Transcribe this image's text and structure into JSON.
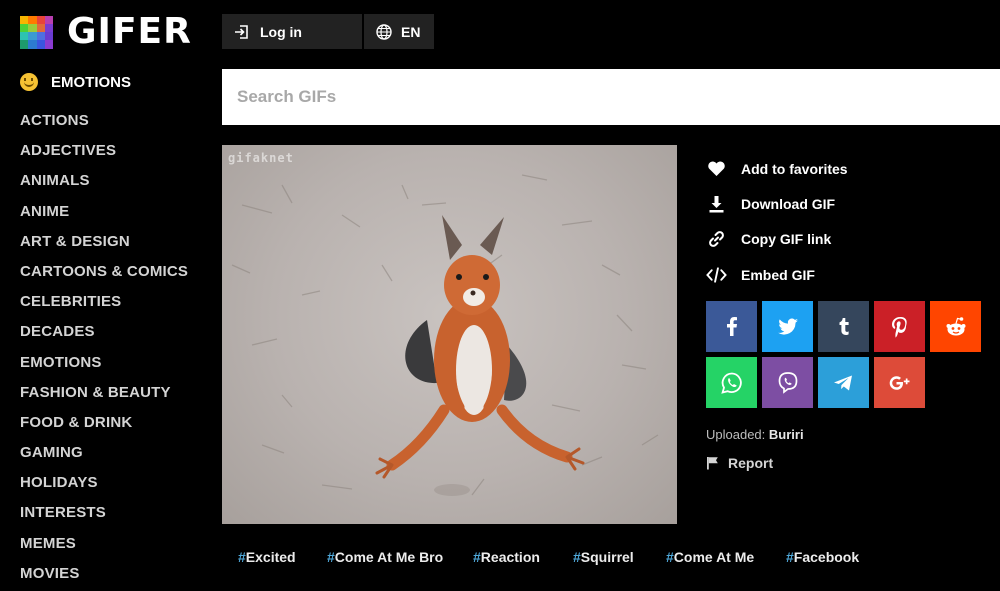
{
  "brand": {
    "name": "GIFER",
    "logo_colors": [
      "#f7b500",
      "#ff7a00",
      "#e8443a",
      "#b83fb0",
      "#4cd137",
      "#9bcb3b",
      "#e06a3b",
      "#7a3bd1",
      "#2dc3b0",
      "#3b9bd1",
      "#4f6fe0",
      "#6a3bd1",
      "#1d9b6c",
      "#2d7bd1",
      "#3b55e0",
      "#8b3bd1"
    ]
  },
  "header": {
    "login_label": "Log in",
    "lang_label": "EN",
    "login_icon": "login-icon",
    "lang_icon": "globe-icon"
  },
  "search": {
    "placeholder": "Search GIFs"
  },
  "sidebar": {
    "header_label": "EMOTIONS",
    "header_icon": "smiley-icon",
    "items": [
      "ACTIONS",
      "ADJECTIVES",
      "ANIMALS",
      "ANIME",
      "ART & DESIGN",
      "CARTOONS & COMICS",
      "CELEBRITIES",
      "DECADES",
      "EMOTIONS",
      "FASHION & BEAUTY",
      "FOOD & DRINK",
      "GAMING",
      "HOLIDAYS",
      "INTERESTS",
      "MEMES",
      "MOVIES"
    ]
  },
  "gif": {
    "watermark": "gifaknet"
  },
  "actions": [
    {
      "label": "Add to favorites",
      "icon": "heart-icon"
    },
    {
      "label": "Download GIF",
      "icon": "download-icon"
    },
    {
      "label": "Copy GIF link",
      "icon": "link-icon"
    },
    {
      "label": "Embed GIF",
      "icon": "code-icon"
    }
  ],
  "share": [
    {
      "name": "facebook",
      "color": "#3b5998"
    },
    {
      "name": "twitter",
      "color": "#1da1f2"
    },
    {
      "name": "tumblr",
      "color": "#35465c"
    },
    {
      "name": "pinterest",
      "color": "#cb2027"
    },
    {
      "name": "reddit",
      "color": "#ff4500"
    },
    {
      "name": "whatsapp",
      "color": "#25d366"
    },
    {
      "name": "viber",
      "color": "#7d4ea3"
    },
    {
      "name": "telegram",
      "color": "#2c9fd9"
    },
    {
      "name": "google-plus",
      "color": "#dd4b39"
    }
  ],
  "meta": {
    "uploaded_label": "Uploaded:",
    "uploader": "Buriri",
    "report_label": "Report"
  },
  "tags": [
    "Excited",
    "Come At Me Bro",
    "Reaction",
    "Squirrel",
    "Come At Me",
    "Facebook"
  ],
  "tag_prefix": "#",
  "accent_color": "#4fa8d9"
}
